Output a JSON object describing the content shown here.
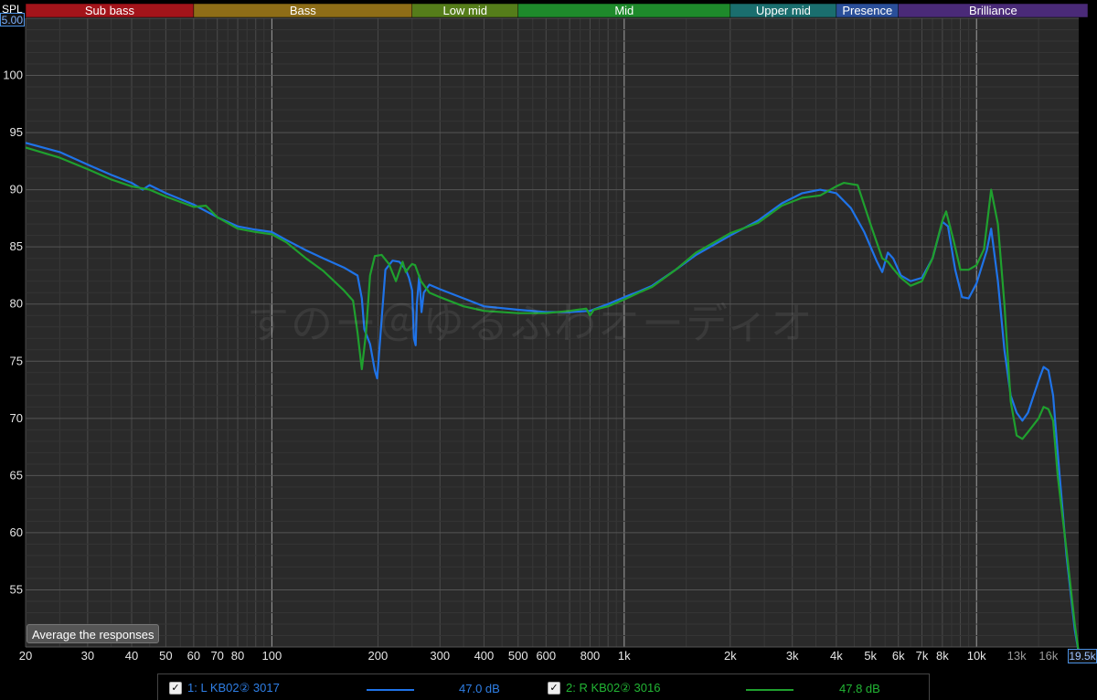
{
  "ui": {
    "spl_label": "SPL",
    "y_top_value": "5.00",
    "x_end_value": "19.5k",
    "average_button": "Average the responses",
    "watermark": "すのー＠ゆるふわオーディオ"
  },
  "legend": [
    {
      "label": "1: L KB02② 3017",
      "value": "47.0 dB",
      "color": "#1f73e8"
    },
    {
      "label": "2: R KB02② 3016",
      "value": "47.8 dB",
      "color": "#1fa02e"
    }
  ],
  "chart_data": {
    "type": "line",
    "x_scale": "log",
    "xlim": [
      20,
      19500
    ],
    "ylim": [
      50,
      105
    ],
    "grid": true,
    "bands": [
      {
        "name": "Sub bass",
        "from": 20,
        "to": 60,
        "color": "#a3141a"
      },
      {
        "name": "Bass",
        "from": 60,
        "to": 250,
        "color": "#8e6d17"
      },
      {
        "name": "Low mid",
        "from": 250,
        "to": 500,
        "color": "#557d1a"
      },
      {
        "name": "Mid",
        "from": 500,
        "to": 2000,
        "color": "#1e8a2b"
      },
      {
        "name": "Upper mid",
        "from": 2000,
        "to": 4000,
        "color": "#1a6e6e"
      },
      {
        "name": "Presence",
        "from": 4000,
        "to": 6000,
        "color": "#2a4f9a"
      },
      {
        "name": "Brilliance",
        "from": 6000,
        "to": 20000,
        "color": "#4a2a78"
      }
    ],
    "x_ticks": [
      {
        "v": 20,
        "t": "20",
        "major": true
      },
      {
        "v": 30,
        "t": "30",
        "major": true
      },
      {
        "v": 40,
        "t": "40",
        "major": true
      },
      {
        "v": 50,
        "t": "50",
        "major": true
      },
      {
        "v": 60,
        "t": "60",
        "major": true
      },
      {
        "v": 70,
        "t": "70",
        "major": true
      },
      {
        "v": 80,
        "t": "80",
        "major": true
      },
      {
        "v": 100,
        "t": "100",
        "major": true
      },
      {
        "v": 200,
        "t": "200",
        "major": true
      },
      {
        "v": 300,
        "t": "300",
        "major": true
      },
      {
        "v": 400,
        "t": "400",
        "major": true
      },
      {
        "v": 500,
        "t": "500",
        "major": true
      },
      {
        "v": 600,
        "t": "600",
        "major": true
      },
      {
        "v": 800,
        "t": "800",
        "major": true
      },
      {
        "v": 1000,
        "t": "1k",
        "major": true
      },
      {
        "v": 2000,
        "t": "2k",
        "major": true
      },
      {
        "v": 3000,
        "t": "3k",
        "major": true
      },
      {
        "v": 4000,
        "t": "4k",
        "major": true
      },
      {
        "v": 5000,
        "t": "5k",
        "major": true
      },
      {
        "v": 6000,
        "t": "6k",
        "major": true
      },
      {
        "v": 7000,
        "t": "7k",
        "major": true
      },
      {
        "v": 8000,
        "t": "8k",
        "major": true
      },
      {
        "v": 10000,
        "t": "10k",
        "major": true
      },
      {
        "v": 13000,
        "t": "13k",
        "major": false
      },
      {
        "v": 16000,
        "t": "16k",
        "major": false
      }
    ],
    "y_ticks": [
      55,
      60,
      65,
      70,
      75,
      80,
      85,
      90,
      95,
      100
    ],
    "series": [
      {
        "name": "1: L KB02② 3017",
        "color": "#1f73e8",
        "points": [
          [
            20,
            94.1
          ],
          [
            25,
            93.3
          ],
          [
            30,
            92.2
          ],
          [
            35,
            91.3
          ],
          [
            40,
            90.6
          ],
          [
            43,
            90.0
          ],
          [
            45,
            90.4
          ],
          [
            50,
            89.7
          ],
          [
            60,
            88.7
          ],
          [
            70,
            87.6
          ],
          [
            80,
            86.8
          ],
          [
            90,
            86.5
          ],
          [
            100,
            86.3
          ],
          [
            110,
            85.6
          ],
          [
            125,
            84.7
          ],
          [
            140,
            84.0
          ],
          [
            160,
            83.2
          ],
          [
            175,
            82.5
          ],
          [
            180,
            80.5
          ],
          [
            183,
            77.8
          ],
          [
            190,
            76.5
          ],
          [
            196,
            74.2
          ],
          [
            199,
            73.5
          ],
          [
            203,
            77.0
          ],
          [
            210,
            83.0
          ],
          [
            220,
            83.8
          ],
          [
            230,
            83.7
          ],
          [
            240,
            83.0
          ],
          [
            245,
            82.3
          ],
          [
            250,
            81.2
          ],
          [
            253,
            77.0
          ],
          [
            256,
            76.4
          ],
          [
            258,
            80.0
          ],
          [
            262,
            82.5
          ],
          [
            266,
            79.3
          ],
          [
            270,
            81.0
          ],
          [
            280,
            81.7
          ],
          [
            300,
            81.3
          ],
          [
            350,
            80.5
          ],
          [
            400,
            79.8
          ],
          [
            500,
            79.5
          ],
          [
            600,
            79.3
          ],
          [
            700,
            79.3
          ],
          [
            800,
            79.4
          ],
          [
            900,
            80.0
          ],
          [
            1000,
            80.6
          ],
          [
            1100,
            81.1
          ],
          [
            1200,
            81.6
          ],
          [
            1400,
            83.0
          ],
          [
            1600,
            84.3
          ],
          [
            2000,
            86.0
          ],
          [
            2400,
            87.3
          ],
          [
            2800,
            88.8
          ],
          [
            3200,
            89.7
          ],
          [
            3600,
            90.0
          ],
          [
            4000,
            89.7
          ],
          [
            4400,
            88.4
          ],
          [
            4800,
            86.3
          ],
          [
            5200,
            83.8
          ],
          [
            5400,
            82.8
          ],
          [
            5600,
            84.5
          ],
          [
            5800,
            84.0
          ],
          [
            6100,
            82.5
          ],
          [
            6500,
            82.0
          ],
          [
            7000,
            82.3
          ],
          [
            7500,
            84.0
          ],
          [
            8000,
            87.2
          ],
          [
            8300,
            86.8
          ],
          [
            8700,
            83.0
          ],
          [
            9100,
            80.6
          ],
          [
            9500,
            80.5
          ],
          [
            10000,
            81.8
          ],
          [
            10700,
            84.7
          ],
          [
            11000,
            86.6
          ],
          [
            11500,
            82.0
          ],
          [
            12000,
            76.0
          ],
          [
            12500,
            72.0
          ],
          [
            13000,
            70.5
          ],
          [
            13500,
            69.8
          ],
          [
            14000,
            70.5
          ],
          [
            15000,
            73.3
          ],
          [
            15500,
            74.5
          ],
          [
            16000,
            74.2
          ],
          [
            16500,
            72.0
          ],
          [
            17000,
            67.0
          ],
          [
            18000,
            58.0
          ],
          [
            19000,
            51.5
          ],
          [
            19500,
            49.5
          ]
        ]
      },
      {
        "name": "2: R KB02② 3016",
        "color": "#1fa02e",
        "points": [
          [
            20,
            93.7
          ],
          [
            25,
            92.8
          ],
          [
            30,
            91.8
          ],
          [
            35,
            90.9
          ],
          [
            40,
            90.3
          ],
          [
            45,
            90.0
          ],
          [
            50,
            89.4
          ],
          [
            60,
            88.5
          ],
          [
            65,
            88.6
          ],
          [
            70,
            87.6
          ],
          [
            80,
            86.6
          ],
          [
            90,
            86.3
          ],
          [
            100,
            86.1
          ],
          [
            110,
            85.4
          ],
          [
            125,
            84.0
          ],
          [
            140,
            82.9
          ],
          [
            160,
            81.2
          ],
          [
            170,
            80.3
          ],
          [
            175,
            77.5
          ],
          [
            180,
            74.3
          ],
          [
            185,
            77.5
          ],
          [
            190,
            82.5
          ],
          [
            196,
            84.2
          ],
          [
            205,
            84.3
          ],
          [
            215,
            83.5
          ],
          [
            225,
            82.0
          ],
          [
            235,
            83.7
          ],
          [
            240,
            82.8
          ],
          [
            245,
            83.2
          ],
          [
            250,
            83.5
          ],
          [
            255,
            83.4
          ],
          [
            265,
            82.0
          ],
          [
            280,
            81.0
          ],
          [
            300,
            80.6
          ],
          [
            350,
            79.8
          ],
          [
            400,
            79.4
          ],
          [
            500,
            79.2
          ],
          [
            600,
            79.2
          ],
          [
            700,
            79.4
          ],
          [
            780,
            79.6
          ],
          [
            800,
            79.0
          ],
          [
            820,
            79.5
          ],
          [
            900,
            79.8
          ],
          [
            1000,
            80.4
          ],
          [
            1100,
            81.0
          ],
          [
            1200,
            81.5
          ],
          [
            1400,
            83.0
          ],
          [
            1600,
            84.5
          ],
          [
            2000,
            86.2
          ],
          [
            2400,
            87.1
          ],
          [
            2800,
            88.6
          ],
          [
            3200,
            89.3
          ],
          [
            3600,
            89.5
          ],
          [
            4000,
            90.3
          ],
          [
            4200,
            90.6
          ],
          [
            4600,
            90.4
          ],
          [
            5000,
            87.0
          ],
          [
            5400,
            84.0
          ],
          [
            5600,
            83.7
          ],
          [
            5800,
            83.1
          ],
          [
            6100,
            82.3
          ],
          [
            6500,
            81.6
          ],
          [
            7000,
            82.0
          ],
          [
            7500,
            84.0
          ],
          [
            8000,
            87.3
          ],
          [
            8200,
            88.1
          ],
          [
            8600,
            85.6
          ],
          [
            9000,
            83.0
          ],
          [
            9500,
            83.0
          ],
          [
            10000,
            83.4
          ],
          [
            10500,
            84.8
          ],
          [
            11000,
            90.0
          ],
          [
            11500,
            87.0
          ],
          [
            12000,
            80.0
          ],
          [
            12500,
            71.5
          ],
          [
            13000,
            68.5
          ],
          [
            13500,
            68.2
          ],
          [
            14000,
            68.8
          ],
          [
            15000,
            70.0
          ],
          [
            15500,
            71.0
          ],
          [
            16000,
            70.8
          ],
          [
            16500,
            69.8
          ],
          [
            17000,
            65.0
          ],
          [
            18000,
            58.5
          ],
          [
            19000,
            52.0
          ],
          [
            19500,
            49.5
          ]
        ]
      }
    ]
  }
}
